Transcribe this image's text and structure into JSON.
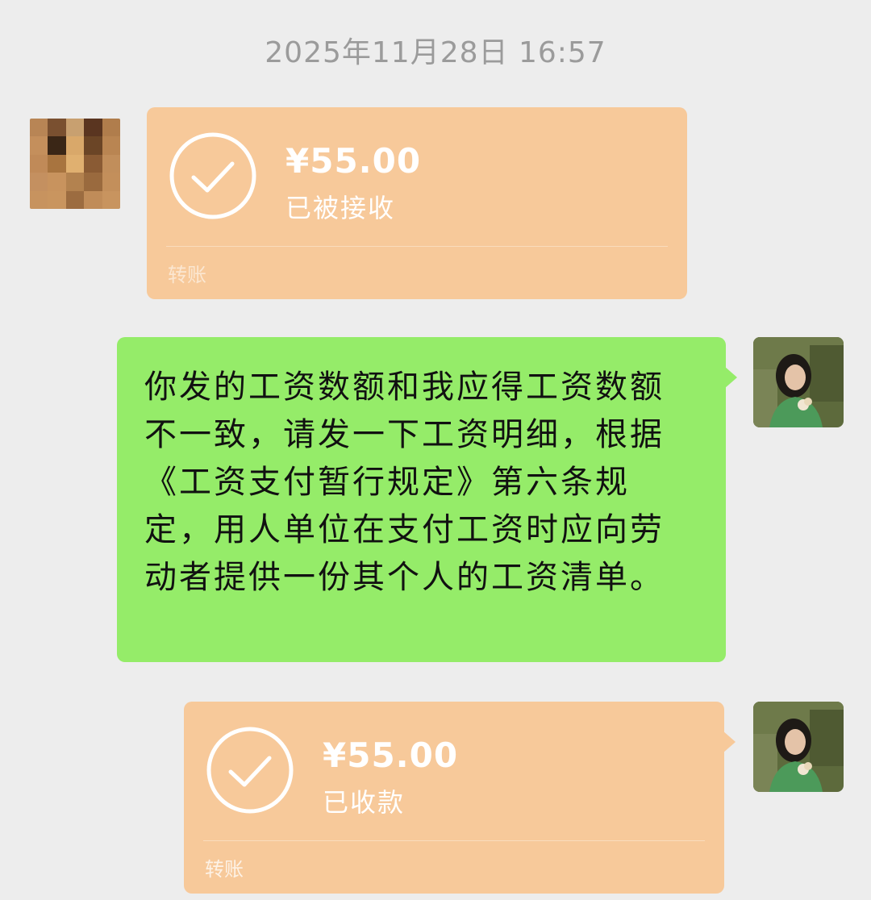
{
  "timestamp": "2025年11月28日 16:57",
  "messages": [
    {
      "type": "transfer",
      "sender": "other",
      "amount": "¥55.00",
      "status": "已被接收",
      "footer": "转账"
    },
    {
      "type": "text",
      "sender": "me",
      "text": "你发的工资数额和我应得工资数额不一致，请发一下工资明细，根据《工资支付暂行规定》第六条规定，用人单位在支付工资时应向劳动者提供一份其个人的工资清单。"
    },
    {
      "type": "transfer",
      "sender": "me",
      "amount": "¥55.00",
      "status": "已收款",
      "footer": "转账"
    }
  ],
  "colors": {
    "background": "#ededed",
    "transfer_bubble": "#f7c99a",
    "my_text_bubble": "#95ec69",
    "timestamp_text": "#9b9b9b"
  },
  "icons": {
    "transfer_status": "check-circle-icon",
    "other_avatar": "pixelated-avatar",
    "my_avatar": "photo-avatar"
  }
}
